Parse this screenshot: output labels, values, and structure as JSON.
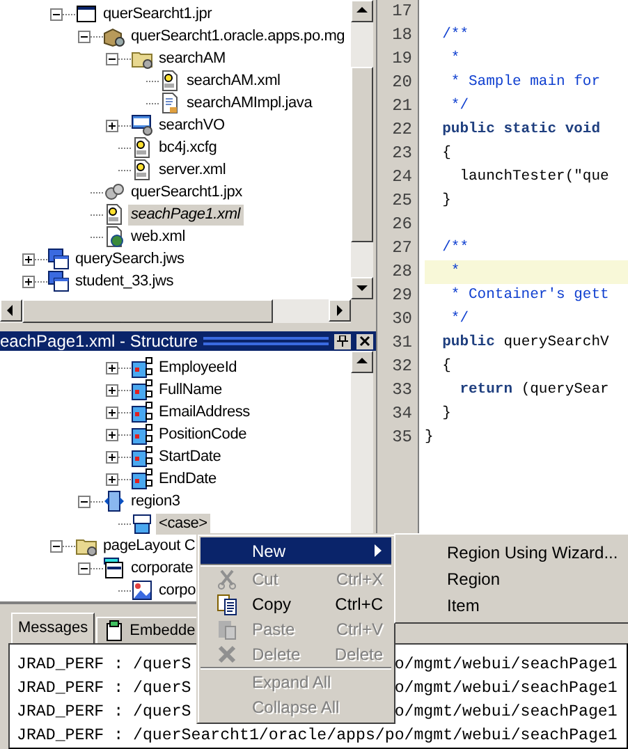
{
  "navigator": {
    "tree": [
      {
        "children": [
          {
            "label": "querSearcht1.jpr",
            "kind": "project",
            "expanded": true,
            "selected": false,
            "open": false,
            "children": [
              {
                "label": "querSearcht1.oracle.apps.po.mg",
                "kind": "package",
                "expanded": true,
                "selected": false,
                "open": false,
                "children": [
                  {
                    "label": "searchAM",
                    "kind": "folder",
                    "expanded": true,
                    "selected": false,
                    "open": false,
                    "children": [
                      {
                        "label": "searchAM.xml",
                        "kind": "xml",
                        "selected": false,
                        "open": false
                      },
                      {
                        "label": "searchAMImpl.java",
                        "kind": "java",
                        "selected": false,
                        "open": false
                      }
                    ]
                  },
                  {
                    "label": "searchVO",
                    "kind": "viewobject",
                    "expanded": false,
                    "selected": false,
                    "open": false
                  },
                  {
                    "label": "bc4j.xcfg",
                    "kind": "xml",
                    "selected": false,
                    "open": false
                  },
                  {
                    "label": "server.xml",
                    "kind": "xml",
                    "selected": false,
                    "open": false
                  }
                ]
              },
              {
                "label": "querSearcht1.jpx",
                "kind": "gears",
                "selected": false,
                "open": false
              },
              {
                "label": "seachPage1.xml",
                "kind": "xml",
                "selected": true,
                "open": true
              },
              {
                "label": "web.xml",
                "kind": "web",
                "selected": false,
                "open": false
              }
            ]
          }
        ]
      },
      {
        "label": "querySearch.jws",
        "kind": "workspace",
        "expanded": false,
        "selected": false,
        "open": false
      },
      {
        "label": "student_33.jws",
        "kind": "workspace",
        "expanded": false,
        "selected": false,
        "open": false
      }
    ]
  },
  "structure": {
    "title": "eachPage1.xml - Structure",
    "tree": [
      {
        "children": [
          {
            "children": [
              {
                "children": [
                  {
                    "label": "EmployeeId",
                    "kind": "attribute",
                    "expanded": false,
                    "selected": false
                  },
                  {
                    "label": "FullName",
                    "kind": "attribute",
                    "expanded": false,
                    "selected": false
                  },
                  {
                    "label": "EmailAddress",
                    "kind": "attribute",
                    "expanded": false,
                    "selected": false
                  },
                  {
                    "label": "PositionCode",
                    "kind": "attribute",
                    "expanded": false,
                    "selected": false
                  },
                  {
                    "label": "StartDate",
                    "kind": "attribute",
                    "expanded": false,
                    "selected": false
                  },
                  {
                    "label": "EndDate",
                    "kind": "attribute",
                    "expanded": false,
                    "selected": false
                  }
                ]
              },
              {
                "label": "region3",
                "kind": "region",
                "expanded": true,
                "selected": false,
                "children": [
                  {
                    "label": "<case>",
                    "kind": "case",
                    "selected": true
                  }
                ]
              }
            ]
          },
          {
            "label": "pageLayout C",
            "kind": "folder",
            "expanded": true,
            "selected": false,
            "children": [
              {
                "label": "corporate",
                "kind": "header",
                "expanded": true,
                "selected": false,
                "children": [
                  {
                    "label": "corpo",
                    "kind": "image",
                    "selected": false
                  }
                ]
              }
            ]
          }
        ]
      }
    ]
  },
  "editor": {
    "lines": [
      {
        "number": "17",
        "highlighted": false
      },
      {
        "number": "18",
        "highlighted": false,
        "tokens": [
          {
            "kind": "comment",
            "text": "  /**"
          }
        ]
      },
      {
        "number": "19",
        "highlighted": false,
        "tokens": [
          {
            "kind": "comment",
            "text": "   *"
          }
        ]
      },
      {
        "number": "20",
        "highlighted": false,
        "tokens": [
          {
            "kind": "comment",
            "text": "   * Sample main for"
          }
        ]
      },
      {
        "number": "21",
        "highlighted": false,
        "tokens": [
          {
            "kind": "comment",
            "text": "   */"
          }
        ]
      },
      {
        "number": "22",
        "highlighted": false,
        "tokens": [
          {
            "kind": "keyword",
            "text": "  public static void"
          }
        ]
      },
      {
        "number": "23",
        "highlighted": false,
        "tokens": [
          {
            "kind": "plain",
            "text": "  {"
          }
        ]
      },
      {
        "number": "24",
        "highlighted": false,
        "tokens": [
          {
            "kind": "plain",
            "text": "    launchTester(\"que"
          }
        ]
      },
      {
        "number": "25",
        "highlighted": false,
        "tokens": [
          {
            "kind": "plain",
            "text": "  }"
          }
        ]
      },
      {
        "number": "26",
        "highlighted": false
      },
      {
        "number": "27",
        "highlighted": false,
        "tokens": [
          {
            "kind": "comment",
            "text": "  /**"
          }
        ]
      },
      {
        "number": "28",
        "highlighted": true,
        "tokens": [
          {
            "kind": "comment",
            "text": "   *"
          }
        ]
      },
      {
        "number": "29",
        "highlighted": false,
        "tokens": [
          {
            "kind": "comment",
            "text": "   * Container's gett"
          }
        ]
      },
      {
        "number": "30",
        "highlighted": false,
        "tokens": [
          {
            "kind": "comment",
            "text": "   */"
          }
        ]
      },
      {
        "number": "31",
        "highlighted": false,
        "tokens": [
          {
            "kind": "keyword",
            "text": "  public"
          },
          {
            "kind": "plain",
            "text": " querySearchV"
          }
        ]
      },
      {
        "number": "32",
        "highlighted": false,
        "tokens": [
          {
            "kind": "plain",
            "text": "  {"
          }
        ]
      },
      {
        "number": "33",
        "highlighted": false,
        "tokens": [
          {
            "kind": "keyword",
            "text": "    return"
          },
          {
            "kind": "plain",
            "text": " (querySear"
          }
        ]
      },
      {
        "number": "34",
        "highlighted": false,
        "tokens": [
          {
            "kind": "plain",
            "text": "  }"
          }
        ]
      },
      {
        "number": "35",
        "highlighted": false,
        "tokens": [
          {
            "kind": "plain",
            "text": "}"
          }
        ]
      }
    ]
  },
  "messages": {
    "tabs": [
      {
        "label": "Messages",
        "kind": "plain",
        "selected": true
      },
      {
        "label": "Embedde",
        "kind": "icon",
        "selected": false
      }
    ],
    "log": [
      {
        "segments": [
          "JRAD_PERF : /querS",
          "o/mgmt/webui/seachPage1"
        ]
      },
      {
        "segments": [
          "JRAD_PERF : /querS",
          "o/mgmt/webui/seachPage1"
        ]
      },
      {
        "segments": [
          "JRAD_PERF : /querS",
          "o/mgmt/webui/seachPage1"
        ]
      },
      {
        "segments": [
          "JRAD_PERF : /querSearcht1/oracle/apps/po/mgmt/webui/seachPage1"
        ]
      }
    ]
  },
  "context_menu": {
    "items": [
      {
        "kind": "submenu",
        "label": "New",
        "selected": true,
        "disabled": false
      },
      {
        "kind": "separator"
      },
      {
        "kind": "cut",
        "label": "Cut",
        "shortcut": "Ctrl+X",
        "selected": false,
        "disabled": true
      },
      {
        "kind": "copy",
        "label": "Copy",
        "shortcut": "Ctrl+C",
        "selected": false,
        "disabled": false
      },
      {
        "kind": "paste",
        "label": "Paste",
        "shortcut": "Ctrl+V",
        "selected": false,
        "disabled": true
      },
      {
        "kind": "delete",
        "label": "Delete",
        "shortcut": "Delete",
        "selected": false,
        "disabled": true
      },
      {
        "kind": "separator"
      },
      {
        "kind": "plain",
        "label": "Expand All",
        "selected": false,
        "disabled": true
      },
      {
        "kind": "plain",
        "label": "Collapse All",
        "selected": false,
        "disabled": true
      }
    ],
    "submenu": [
      {
        "label": "Region Using Wizard...",
        "selected": false
      },
      {
        "label": "Region",
        "selected": false
      },
      {
        "label": "Item",
        "selected": false
      }
    ]
  }
}
